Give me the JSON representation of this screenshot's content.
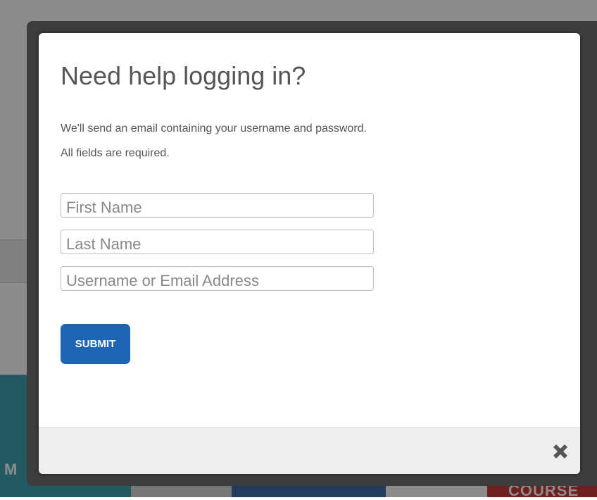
{
  "modal": {
    "title": "Need help logging in?",
    "description_line1": "We'll send an email containing your username and password.",
    "description_line2": "All fields are required.",
    "fields": {
      "first_name_placeholder": "First Name",
      "last_name_placeholder": "Last Name",
      "username_placeholder": "Username or Email Address"
    },
    "submit_label": "SUBMIT",
    "close_icon": "close-x-icon"
  },
  "background": {
    "left_tile_label": "M",
    "right_tile_label": "COURSE",
    "colors": {
      "teal": "#3fa3b3",
      "blue": "#3c6ea8",
      "red": "#c93a38"
    }
  },
  "colors": {
    "submit_button": "#1f64b2",
    "title_text": "#555555",
    "footer": "#eeeeee"
  }
}
